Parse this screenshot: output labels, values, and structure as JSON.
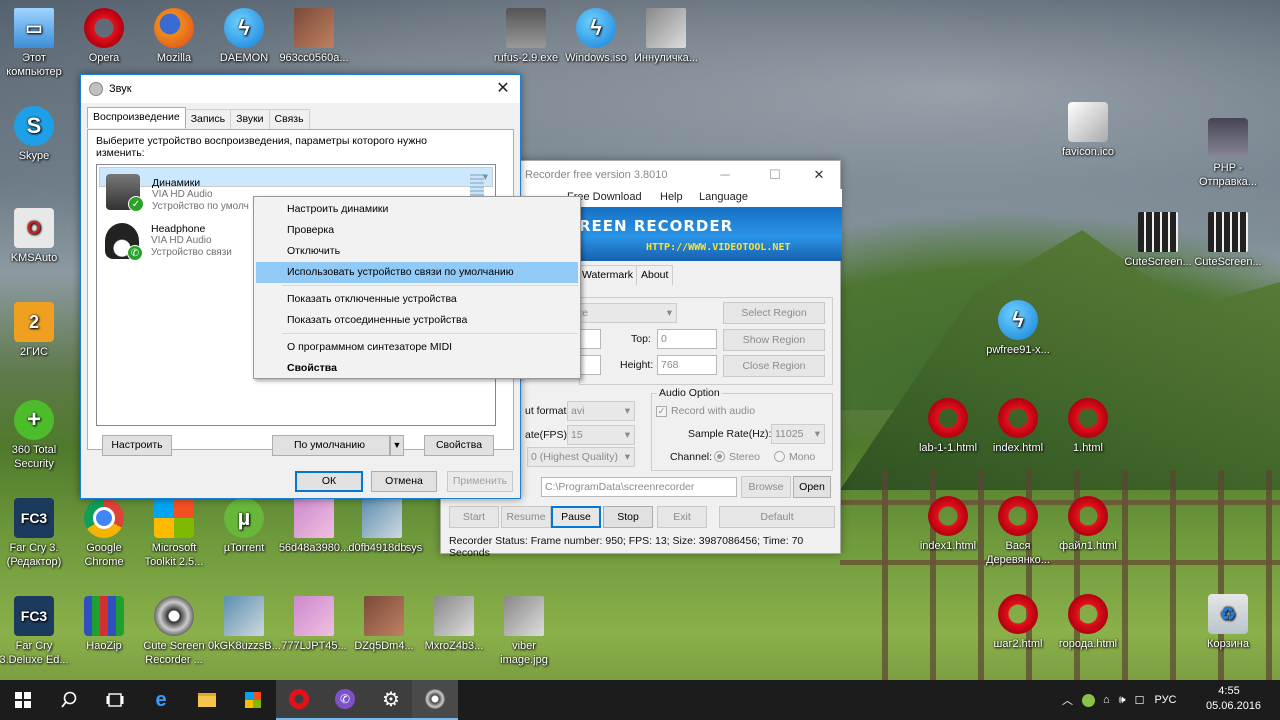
{
  "desktop_icons": {
    "this_pc": "Этот компьютер",
    "opera": "Opera",
    "firefox": "Mozilla",
    "daemon": "DAEMON",
    "photo_963": "963cc0560a...",
    "rufus": "rufus-2.9.exe",
    "windows_iso": "Windows.iso",
    "innulichka": "Иннуличка...",
    "skype": "Skype",
    "kmsauto": "KMSAuto",
    "gis": "2ГИС",
    "ts360": "360 Total Security",
    "farcry_editor": "Far Cry 3.(Редактор)",
    "chrome": "Google Chrome",
    "ms_toolkit": "Microsoft Toolkit 2.5...",
    "utorrent": "µTorrent",
    "photo_56d": "56d48a3980...",
    "photo_d0f": "d0fb4918db...",
    "sys": "sys",
    "farcry_deluxe": "Far Cry 3.Deluxe Ed...",
    "haozip": "HaoZip",
    "cute_desk": "Cute Screen Recorder ...",
    "photo_0kg": "0kGK8uzzsB...",
    "photo_777": "777LJPT45...",
    "photo_dzq": "DZq5Dm4...",
    "photo_mxro": "MxroZ4b3...",
    "viber_img": "viber image.jpg",
    "favicon": "favicon.ico",
    "php": "PHP - Отправка...",
    "cutescreen1": "CuteScreen...",
    "cutescreen2": "CuteScreen...",
    "pwfree": "pwfree91-x...",
    "lab": "lab-1-1.html",
    "index": "index.html",
    "one": "1.html",
    "index1": "index1.html",
    "vasya": "Вася Деревянко...",
    "file1": "файл1.html",
    "shag2": "шаг2.html",
    "goroda": "города.html",
    "recycle": "Корзина"
  },
  "sound": {
    "title": "Звук",
    "tabs": [
      "Воспроизведение",
      "Запись",
      "Звуки",
      "Связь"
    ],
    "description": "Выберите устройство воспроизведения, параметры которого нужно изменить:",
    "devices": [
      {
        "name": "Динамики",
        "driver": "VIA HD Audio",
        "status": "Устройство по умолч"
      },
      {
        "name": "Headphone",
        "driver": "VIA HD Audio",
        "status": "Устройство связи"
      }
    ],
    "configure": "Настроить",
    "set_default": "По умолчанию",
    "properties": "Свойства",
    "ok": "ОК",
    "cancel": "Отмена",
    "apply": "Применить"
  },
  "context_menu": {
    "items": [
      "Настроить динамики",
      "Проверка",
      "Отключить",
      "Использовать устройство связи по умолчанию",
      "Показать отключенные устройства",
      "Показать отсоединенные устройства",
      "О программном синтезаторе MIDI",
      "Свойства"
    ]
  },
  "recorder": {
    "title": "Recorder free version 3.8010",
    "menu": [
      "Free Download",
      "Help",
      "Language"
    ],
    "banner_title": "REEN RECORDER",
    "banner_url": "HTTP://WWW.VIDEOTOOL.NET",
    "tabs": [
      "Watermark",
      "About"
    ],
    "region_select": "ze",
    "select_region": "Select Region",
    "show_region": "Show Region",
    "close_region": "Close Region",
    "top_label": "Top:",
    "top_value": "0",
    "height_label": "Height:",
    "height_value": "768",
    "format_label": "ut format:",
    "format_value": "avi",
    "fps_label": "ate(FPS):",
    "fps_value": "15",
    "quality_value": "0 (Highest Quality)",
    "audio_group": "Audio Option",
    "record_audio": "Record with audio",
    "sample_rate_label": "Sample Rate(Hz):",
    "sample_rate_value": "11025",
    "channel_label": "Channel:",
    "stereo": "Stereo",
    "mono": "Mono",
    "path": "C:\\ProgramData\\screenrecorder",
    "browse": "Browse",
    "open": "Open",
    "start": "Start",
    "resume": "Resume",
    "pause": "Pause",
    "stop": "Stop",
    "exit": "Exit",
    "default": "Default",
    "status": "Recorder Status: Frame number: 950; FPS: 13; Size: 3987086456; Time: 70 Seconds"
  },
  "taskbar": {
    "lang": "РУС",
    "time": "4:55",
    "date": "05.06.2016"
  }
}
